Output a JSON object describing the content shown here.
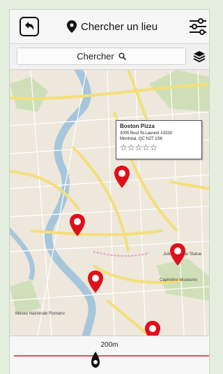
{
  "header": {
    "title": "Chercher un lieu",
    "back_icon": "back-arrow-icon",
    "settings_icon": "sliders-icon"
  },
  "search": {
    "label": "Chercher",
    "icon": "search-icon",
    "layers_icon": "layers-icon"
  },
  "map": {
    "callout": {
      "name": "Boston Pizza",
      "address_line1": "3005 Boul St-Laurent #3330",
      "address_line2": "Montréal, QC H2T 1S6",
      "rating": 5,
      "stars": "☆☆☆☆☆"
    },
    "labels": {
      "colosseum": "Julius Caesar Statue",
      "capitoline": "Capitoline Museums",
      "museum": "Museo Nazionale Romano"
    },
    "pin_color": "#e0101a",
    "pins": [
      {
        "id": "pin-1"
      },
      {
        "id": "pin-2"
      },
      {
        "id": "pin-3"
      },
      {
        "id": "pin-4"
      },
      {
        "id": "pin-5"
      }
    ]
  },
  "slider": {
    "value_label": "200m",
    "track_color": "#d15b5b"
  }
}
